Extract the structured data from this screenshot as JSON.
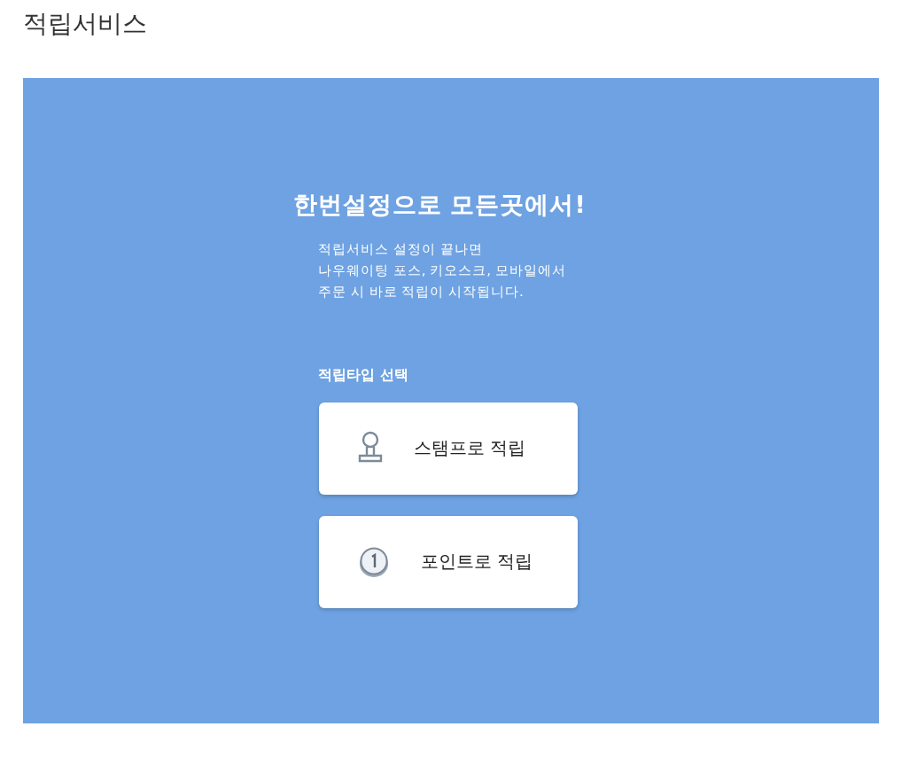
{
  "page_title": "적립서비스",
  "panel": {
    "heading": "한번설정으로 모든곳에서!",
    "description": [
      "적립서비스 설정이 끝나면",
      "나우웨이팅 포스, 키오스크, 모바일에서",
      "주문 시 바로 적립이 시작됩니다."
    ],
    "section_label": "적립타입 선택",
    "options": [
      {
        "kind": "stamp",
        "label": "스탬프로 적립"
      },
      {
        "kind": "point",
        "label": "포인트로 적립"
      }
    ]
  }
}
